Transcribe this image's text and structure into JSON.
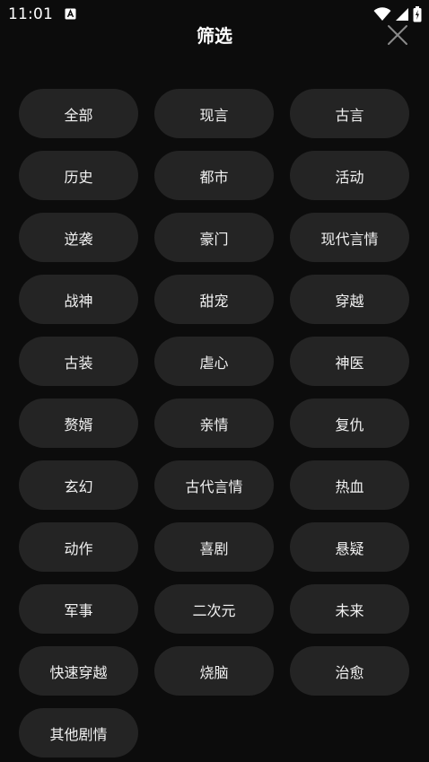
{
  "status_bar": {
    "time": "11:01",
    "icons": [
      "a-notification-icon",
      "wifi-icon",
      "signal-icon",
      "battery-icon"
    ]
  },
  "header": {
    "title": "筛选",
    "close_icon": "close-icon"
  },
  "tags": [
    "全部",
    "现言",
    "古言",
    "历史",
    "都市",
    "活动",
    "逆袭",
    "豪门",
    "现代言情",
    "战神",
    "甜宠",
    "穿越",
    "古装",
    "虐心",
    "神医",
    "赘婿",
    "亲情",
    "复仇",
    "玄幻",
    "古代言情",
    "热血",
    "动作",
    "喜剧",
    "悬疑",
    "军事",
    "二次元",
    "未来",
    "快速穿越",
    "烧脑",
    "治愈",
    "其他剧情"
  ],
  "colors": {
    "background": "#0c0c0c",
    "tag_background": "#242424",
    "text": "#ffffff"
  }
}
